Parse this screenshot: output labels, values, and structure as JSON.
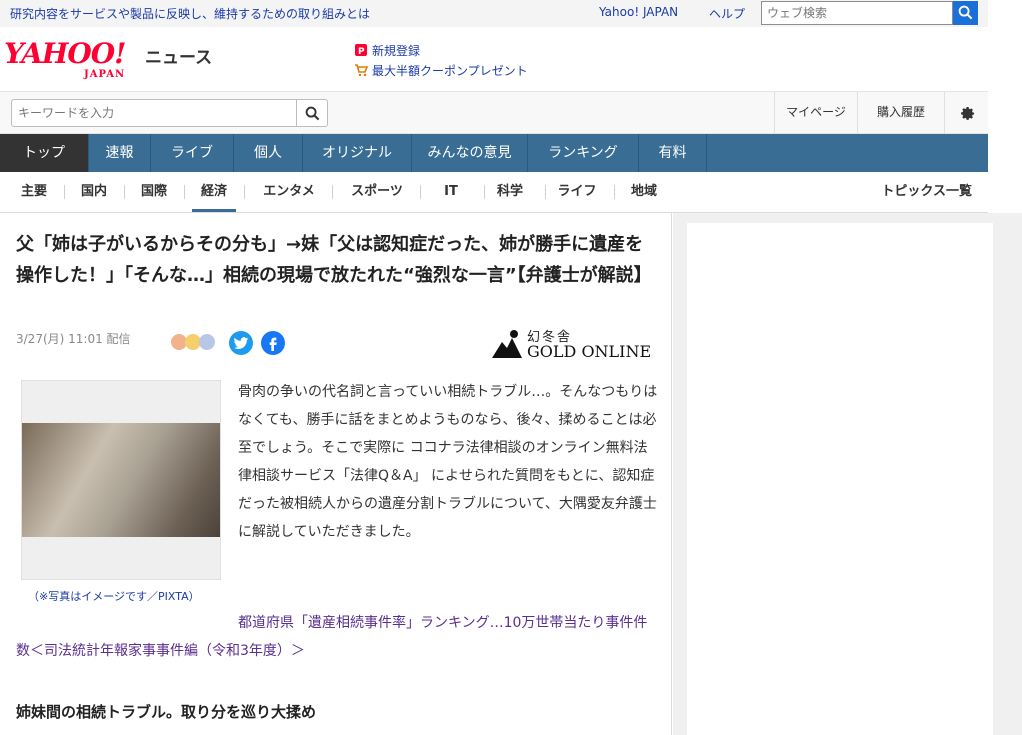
{
  "topbar": {
    "promo_text": "研究内容をサービスや製品に反映し、維持するための取り組みとは",
    "yahoo_japan": "Yahoo! JAPAN",
    "help": "ヘルプ",
    "web_search_placeholder": "ウェブ検索"
  },
  "header": {
    "logo_main": "YAHOO!",
    "logo_sub": "JAPAN",
    "logo_news": "ニュース",
    "promo_register": "新規登録",
    "promo_coupon": "最大半額クーポンプレゼント"
  },
  "search": {
    "placeholder": "キーワードを入力",
    "mypage": "マイページ",
    "history": "購入履歴"
  },
  "main_nav": [
    "トップ",
    "速報",
    "ライブ",
    "個人",
    "オリジナル",
    "みんなの意見",
    "ランキング",
    "有料"
  ],
  "sub_nav": [
    "主要",
    "国内",
    "国際",
    "経済",
    "エンタメ",
    "スポーツ",
    "IT",
    "科学",
    "ライフ",
    "地域"
  ],
  "sub_nav_active": "経済",
  "topics_all": "トピックス一覧",
  "article": {
    "title": "父「姉は子がいるからその分も」→妹「父は認知症だった、姉が勝手に遺産を操作した！」「そんな…」相続の現場で放たれた“強烈な一言”【弁護士が解説】",
    "meta": "3/27(月) 11:01 配信",
    "publisher_kanji": "幻冬舎",
    "publisher_name": "GOLD ONLINE",
    "photo_caption": "（※写真はイメージです／PIXTA）",
    "body": "骨肉の争いの代名詞と言っていい相続トラブル…。そんなつもりはなくても、勝手に話をまとめようものなら、後々、揉めることは必至でしょう。そこで実際に ココナラ法律相談のオンライン無料法律相談サービス「法律Q＆A」 によせられた質問をもとに、認知症だった被相続人からの遺産分割トラブルについて、大隅愛友弁護士に解説していただきました。",
    "related_link": "都道府県「遺産相続事件率」ランキング…10万世帯当たり事件件数＜司法統計年報家事事件編（令和3年度）＞",
    "section_heading": "姉妹間の相続トラブル。取り分を巡り大揉め"
  },
  "colors": {
    "nav_bg": "#3a6d94",
    "nav_active": "#333333",
    "link": "#1a3ba8",
    "visited_link": "#5a2f8f",
    "brand_red": "#ff0033",
    "search_blue": "#1b6fd8"
  }
}
